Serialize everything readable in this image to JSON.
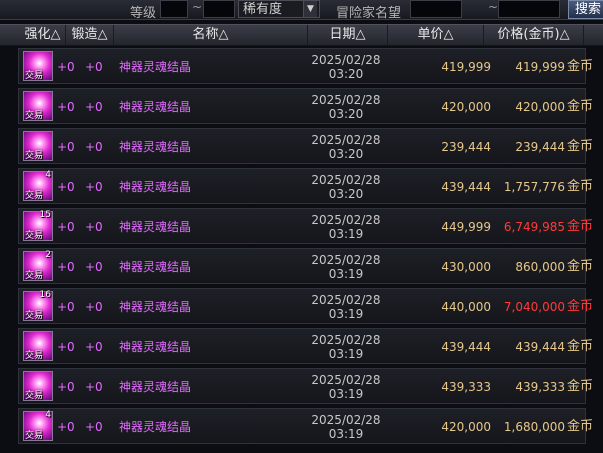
{
  "filter_bar": {
    "level_label": "等级",
    "tilde_1": "~",
    "rarity_select": "稀有度",
    "tilde_2": "~",
    "adventurer_label": "冒险家名望",
    "tilde_3": "~",
    "search_label": "搜索"
  },
  "table": {
    "headers": {
      "enhance": "强化△",
      "forge": "锻造△",
      "name": "名称△",
      "date": "日期△",
      "unit_price": "单价△",
      "price": "价格(金币)△"
    },
    "rows": [
      {
        "stack": "",
        "trade": "交易",
        "enhance": "+0",
        "forge": "+0",
        "name": "神器灵魂结晶",
        "date": "2025/02/28",
        "time": "03:20",
        "unit_price": "419,999",
        "price": "419,999",
        "currency": "金币",
        "highlight": false
      },
      {
        "stack": "",
        "trade": "交易",
        "enhance": "+0",
        "forge": "+0",
        "name": "神器灵魂结晶",
        "date": "2025/02/28",
        "time": "03:20",
        "unit_price": "420,000",
        "price": "420,000",
        "currency": "金币",
        "highlight": false
      },
      {
        "stack": "",
        "trade": "交易",
        "enhance": "+0",
        "forge": "+0",
        "name": "神器灵魂结晶",
        "date": "2025/02/28",
        "time": "03:20",
        "unit_price": "239,444",
        "price": "239,444",
        "currency": "金币",
        "highlight": false
      },
      {
        "stack": "4",
        "trade": "交易",
        "enhance": "+0",
        "forge": "+0",
        "name": "神器灵魂结晶",
        "date": "2025/02/28",
        "time": "03:20",
        "unit_price": "439,444",
        "price": "1,757,776",
        "currency": "金币",
        "highlight": false
      },
      {
        "stack": "15",
        "trade": "交易",
        "enhance": "+0",
        "forge": "+0",
        "name": "神器灵魂结晶",
        "date": "2025/02/28",
        "time": "03:19",
        "unit_price": "449,999",
        "price": "6,749,985",
        "currency": "金币",
        "highlight": true
      },
      {
        "stack": "2",
        "trade": "交易",
        "enhance": "+0",
        "forge": "+0",
        "name": "神器灵魂结晶",
        "date": "2025/02/28",
        "time": "03:19",
        "unit_price": "430,000",
        "price": "860,000",
        "currency": "金币",
        "highlight": false
      },
      {
        "stack": "16",
        "trade": "交易",
        "enhance": "+0",
        "forge": "+0",
        "name": "神器灵魂结晶",
        "date": "2025/02/28",
        "time": "03:19",
        "unit_price": "440,000",
        "price": "7,040,000",
        "currency": "金币",
        "highlight": true
      },
      {
        "stack": "",
        "trade": "交易",
        "enhance": "+0",
        "forge": "+0",
        "name": "神器灵魂结晶",
        "date": "2025/02/28",
        "time": "03:19",
        "unit_price": "439,444",
        "price": "439,444",
        "currency": "金币",
        "highlight": false
      },
      {
        "stack": "",
        "trade": "交易",
        "enhance": "+0",
        "forge": "+0",
        "name": "神器灵魂结晶",
        "date": "2025/02/28",
        "time": "03:19",
        "unit_price": "439,333",
        "price": "439,333",
        "currency": "金币",
        "highlight": false
      },
      {
        "stack": "4",
        "trade": "交易",
        "enhance": "+0",
        "forge": "+0",
        "name": "神器灵魂结晶",
        "date": "2025/02/28",
        "time": "03:19",
        "unit_price": "420,000",
        "price": "1,680,000",
        "currency": "金币",
        "highlight": false
      }
    ]
  },
  "colors": {
    "item_name": "#e26bff",
    "price_gold": "#e6c88c",
    "price_high": "#ff3a3a",
    "icon": "artifact-soul-crystal-icon"
  }
}
